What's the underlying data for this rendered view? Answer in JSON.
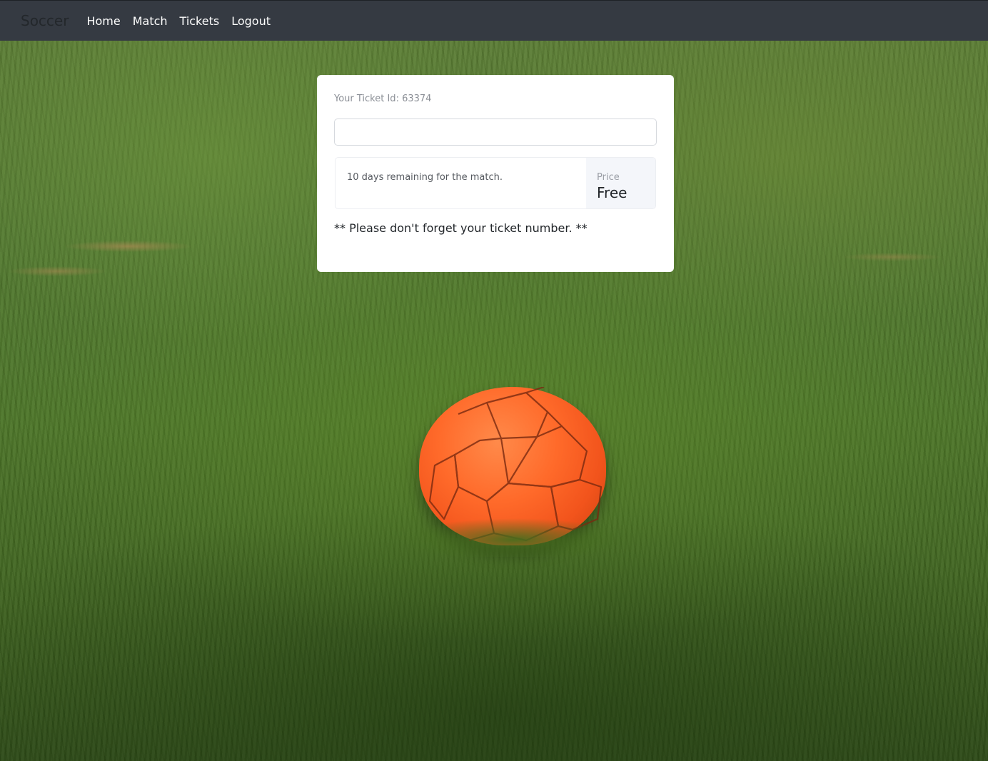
{
  "navbar": {
    "brand": "Soccer",
    "links": [
      "Home",
      "Match",
      "Tickets",
      "Logout"
    ]
  },
  "ticket": {
    "id_label": "Your Ticket Id: 63374",
    "input_value": "",
    "remaining_text": "10 days remaining for the match.",
    "price_label": "Price",
    "price_value": "Free",
    "note": "** Please don't forget your ticket number. **"
  },
  "colors": {
    "navbar_bg": "#353a42",
    "card_bg": "#ffffff",
    "ball": "#ff6a2a"
  }
}
